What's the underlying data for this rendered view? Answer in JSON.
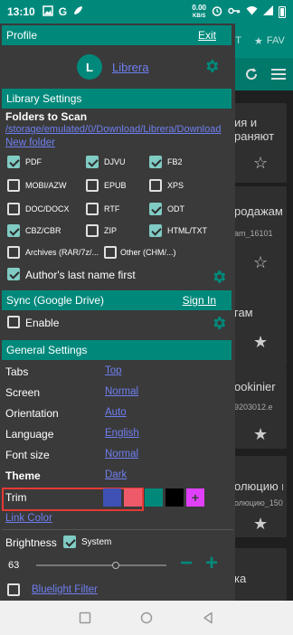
{
  "status_bar": {
    "time": "13:10",
    "net_speed_value": "0.00",
    "net_speed_unit": "KB/S"
  },
  "background": {
    "tab_partial": "T",
    "tab_fav": "FAV",
    "cards": [
      {
        "lines": [
          "ия и",
          "раняют"
        ],
        "small": ""
      },
      {
        "lines": [
          "родажам"
        ],
        "small": "am_16101"
      },
      {
        "lines": [
          "гам"
        ],
        "small": ""
      },
      {
        "lines": [
          "ookinier"
        ],
        "small": "9203012.e"
      },
      {
        "lines": [
          "олюцию в"
        ],
        "small": "олюцию_150"
      },
      {
        "lines": [
          "ка"
        ],
        "small": ""
      }
    ]
  },
  "profile": {
    "title": "Profile",
    "exit": "Exit",
    "avatar_letter": "L",
    "name": "Librera"
  },
  "library": {
    "title": "Library Settings",
    "folders_label": "Folders to Scan",
    "folder_path": "/storage/emulated/0/Download/Librera/Download",
    "new_folder": "New folder",
    "formats": [
      {
        "label": "PDF",
        "checked": true
      },
      {
        "label": "DJVU",
        "checked": true
      },
      {
        "label": "FB2",
        "checked": true
      },
      {
        "label": "MOBI/AZW",
        "checked": false
      },
      {
        "label": "EPUB",
        "checked": false
      },
      {
        "label": "XPS",
        "checked": false
      },
      {
        "label": "DOC/DOCX",
        "checked": false
      },
      {
        "label": "RTF",
        "checked": false
      },
      {
        "label": "ODT",
        "checked": true
      },
      {
        "label": "CBZ/CBR",
        "checked": true
      },
      {
        "label": "ZIP",
        "checked": false
      },
      {
        "label": "HTML/TXT",
        "checked": true
      }
    ],
    "archives": "Archives (RAR/7z/...",
    "other": "Other (CHM/...)",
    "author_last_first": "Author's last name first"
  },
  "sync": {
    "title": "Sync (Google Drive)",
    "sign_in": "Sign In",
    "enable": "Enable"
  },
  "general": {
    "title": "General Settings",
    "rows": [
      {
        "label": "Tabs",
        "value": "Top"
      },
      {
        "label": "Screen",
        "value": "Normal"
      },
      {
        "label": "Orientation",
        "value": "Auto"
      },
      {
        "label": "Language",
        "value": "English"
      },
      {
        "label": "Font size",
        "value": "Normal"
      },
      {
        "label": "Theme",
        "value": "Dark"
      }
    ],
    "trim": "Trim",
    "link_color": "Link Color",
    "swatches": [
      "#3f51b5",
      "#ef5a6a",
      "#00897b",
      "#000000",
      "#e040fb"
    ],
    "brightness": "Brightness",
    "system": "System",
    "brightness_value": "63",
    "brightness_level": 0.61,
    "minus": "−",
    "plus": "+",
    "bluelight": "Bluelight Filter"
  },
  "colors": {
    "accent": "#00897b",
    "link": "#6f7ff0",
    "check": "#80cbc4",
    "highlight": "#e53935"
  }
}
